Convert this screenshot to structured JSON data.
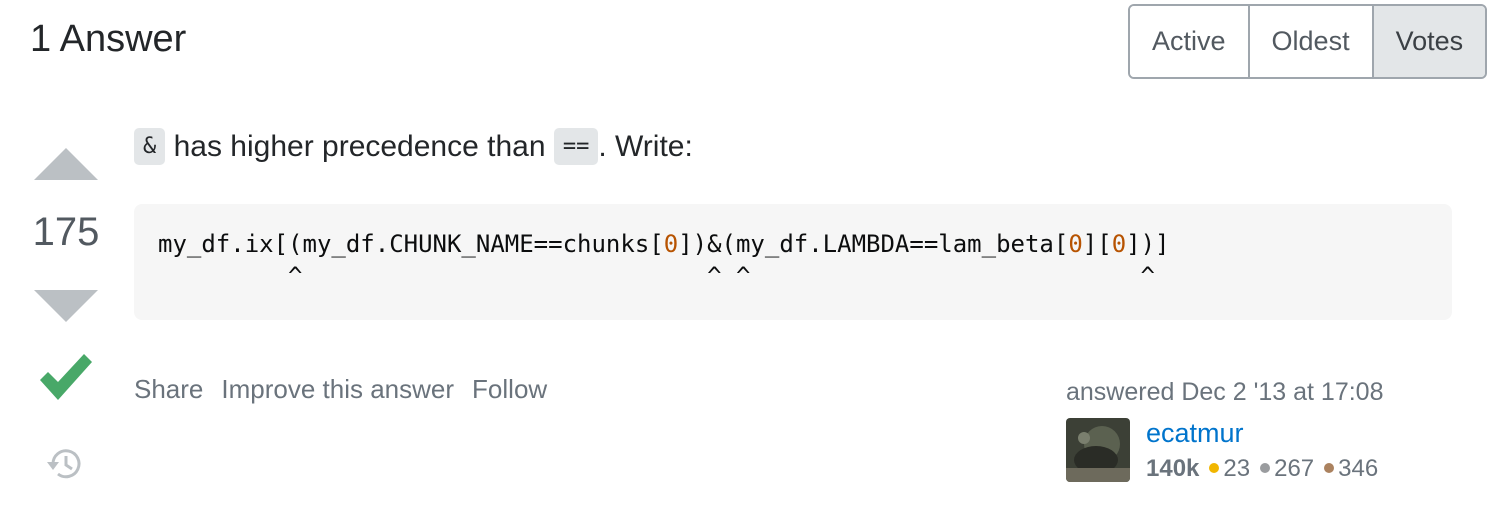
{
  "answers_header": {
    "title": "1 Answer"
  },
  "sort": {
    "options": [
      "Active",
      "Oldest",
      "Votes"
    ],
    "selected": "Votes"
  },
  "answer": {
    "score": "175",
    "accepted": true,
    "text": {
      "code1": "&",
      "part1": " has higher precedence than ",
      "code2": "==",
      "part2": ". Write:"
    },
    "code_block": {
      "line1": [
        {
          "t": "my_df.ix[(my_df.CHUNK_NAME==chunks[",
          "k": "plain"
        },
        {
          "t": "0",
          "k": "num"
        },
        {
          "t": "])&(my_df.LAMBDA==lam_beta[",
          "k": "plain"
        },
        {
          "t": "0",
          "k": "num"
        },
        {
          "t": "][",
          "k": "plain"
        },
        {
          "t": "0",
          "k": "num"
        },
        {
          "t": "])]",
          "k": "plain"
        }
      ],
      "line2": "         ^                            ^ ^                           ^"
    },
    "menu": {
      "share": "Share",
      "improve": "Improve this answer",
      "follow": "Follow"
    },
    "user": {
      "action_time": "answered Dec 2 '13 at 17:08",
      "name": "ecatmur",
      "reputation": "140k",
      "gold": "23",
      "silver": "267",
      "bronze": "346"
    }
  },
  "colors": {
    "accepted": "#48a868",
    "link": "#0074cc",
    "gold": "#f1b600",
    "silver": "#9a9c9f",
    "bronze": "#ab825f"
  },
  "icons": [
    "vote-up-icon",
    "vote-down-icon",
    "accepted-check-icon",
    "history-icon"
  ]
}
